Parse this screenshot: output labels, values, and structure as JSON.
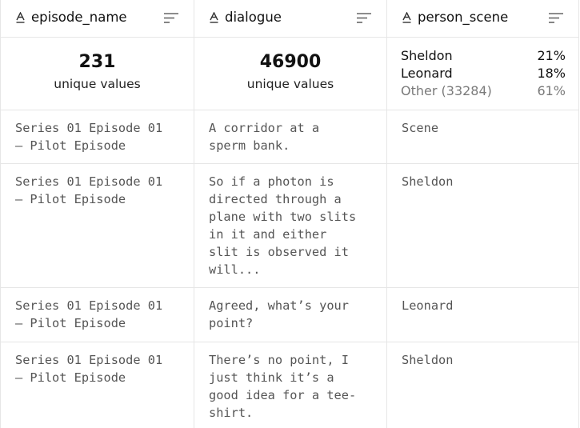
{
  "columns": [
    {
      "name": "episode_name",
      "type_icon": "text-type-icon",
      "summary": {
        "count": "231",
        "label": "unique values"
      }
    },
    {
      "name": "dialogue",
      "type_icon": "text-type-icon",
      "summary": {
        "count": "46900",
        "label": "unique values"
      }
    },
    {
      "name": "person_scene",
      "type_icon": "text-type-icon",
      "distribution": [
        {
          "label": "Sheldon",
          "percent": "21%"
        },
        {
          "label": "Leonard",
          "percent": "18%"
        },
        {
          "label": "Other (33284)",
          "percent": "61%"
        }
      ]
    }
  ],
  "rows": [
    {
      "episode_name": "Series 01 Episode 01\n– Pilot Episode",
      "dialogue": "A corridor at a\nsperm bank.",
      "person_scene": "Scene"
    },
    {
      "episode_name": "Series 01 Episode 01\n– Pilot Episode",
      "dialogue": "So if a photon is\ndirected through a\nplane with two slits\nin it and either\nslit is observed it\nwill...",
      "person_scene": "Sheldon"
    },
    {
      "episode_name": "Series 01 Episode 01\n– Pilot Episode",
      "dialogue": "Agreed, what’s your\npoint?",
      "person_scene": "Leonard"
    },
    {
      "episode_name": "Series 01 Episode 01\n– Pilot Episode",
      "dialogue": "There’s no point, I\njust think it’s a\ngood idea for a tee-\nshirt.",
      "person_scene": "Sheldon"
    }
  ],
  "colors": {
    "border": "#e6e6e6",
    "text": "#111111",
    "muted": "#7a7a7a",
    "cell_text": "#555555"
  }
}
